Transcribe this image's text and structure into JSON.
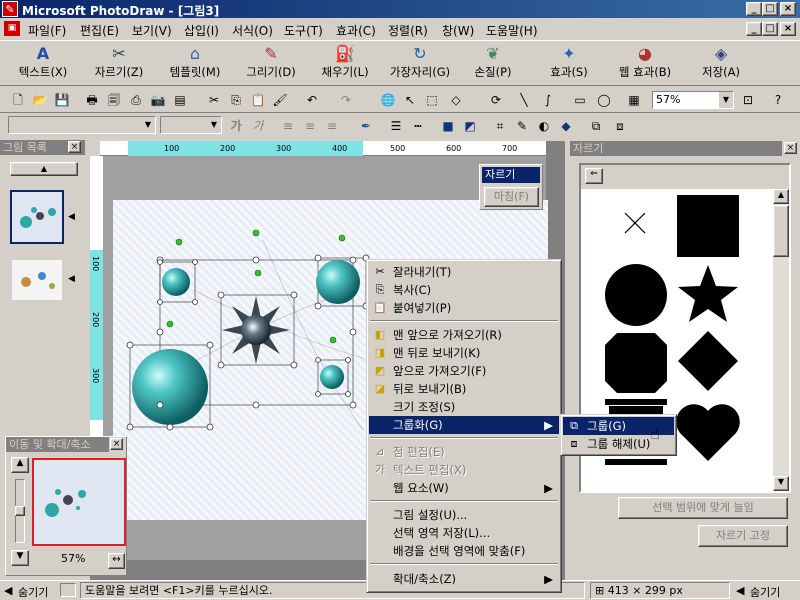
{
  "window": {
    "title": "Microsoft PhotoDraw - [그림3]"
  },
  "menu": [
    "파일(F)",
    "편집(E)",
    "보기(V)",
    "삽입(I)",
    "서식(O)",
    "도구(T)",
    "효과(C)",
    "정렬(R)",
    "창(W)",
    "도움말(H)"
  ],
  "bigtoolbar": [
    {
      "label": "텍스트(X)",
      "icon": "text-icon"
    },
    {
      "label": "자르기(Z)",
      "icon": "scissors-icon"
    },
    {
      "label": "템플릿(M)",
      "icon": "template-icon"
    },
    {
      "label": "그리기(D)",
      "icon": "pencil-icon"
    },
    {
      "label": "채우기(L)",
      "icon": "fill-bucket-icon"
    },
    {
      "label": "가장자리(G)",
      "icon": "edge-icon"
    },
    {
      "label": "손질(P)",
      "icon": "touchup-icon"
    },
    {
      "label": "효과(S)",
      "icon": "effects-icon"
    },
    {
      "label": "웹 효과(B)",
      "icon": "web-effects-icon"
    },
    {
      "label": "저장(A)",
      "icon": "save-icon"
    }
  ],
  "zoom": "57%",
  "left_panel": {
    "title": "그림 목록"
  },
  "navigator": {
    "title": "이동 및 확대/축소",
    "zoom": "57%"
  },
  "ruler": {
    "ticks": [
      "100",
      "200",
      "300",
      "400",
      "500",
      "600",
      "700"
    ]
  },
  "vruler": {
    "ticks": [
      "100",
      "200",
      "300"
    ]
  },
  "crop_popup": {
    "item1": "자르기",
    "item2": "마침(F)"
  },
  "right_panel": {
    "title": "자르기",
    "fit_button": "선택 범위에 맞게 늘임",
    "fix_button": "자르기 고정"
  },
  "context_menu": {
    "items": [
      {
        "label": "잘라내기(T)",
        "icon": "cut-icon",
        "state": "normal"
      },
      {
        "label": "복사(C)",
        "icon": "copy-icon",
        "state": "normal"
      },
      {
        "label": "붙여넣기(P)",
        "icon": "paste-icon",
        "state": "normal"
      },
      {
        "label": "맨 앞으로 가져오기(R)",
        "icon": "bring-front-icon",
        "state": "normal"
      },
      {
        "label": "맨 뒤로 보내기(K)",
        "icon": "send-back-icon",
        "state": "normal"
      },
      {
        "label": "앞으로 가져오기(F)",
        "icon": "bring-forward-icon",
        "state": "normal"
      },
      {
        "label": "뒤로 보내기(B)",
        "icon": "send-backward-icon",
        "state": "normal"
      },
      {
        "label": "크기 조정(S)",
        "icon": "",
        "state": "normal"
      },
      {
        "label": "그룹화(G)",
        "icon": "",
        "state": "selected"
      },
      {
        "label": "점 편집(E)",
        "icon": "point-edit-icon",
        "state": "disabled"
      },
      {
        "label": "텍스트 편집(X)",
        "icon": "text-edit-icon",
        "state": "disabled"
      },
      {
        "label": "웹 요소(W)",
        "icon": "",
        "state": "normal"
      },
      {
        "label": "그림 설정(U)...",
        "icon": "",
        "state": "normal"
      },
      {
        "label": "선택 영역 저장(L)...",
        "icon": "",
        "state": "normal"
      },
      {
        "label": "배경을 선택 영역에 맞춤(F)",
        "icon": "",
        "state": "normal"
      },
      {
        "label": "확대/축소(Z)",
        "icon": "",
        "state": "normal"
      }
    ]
  },
  "submenu": {
    "group": "그룹(G)",
    "ungroup": "그룹 해제(U)"
  },
  "status": {
    "hide_left": "숨기기",
    "help": "도움말을 보려면 <F1>키를 누르십시오.",
    "size": "413 × 299",
    "unit": "px",
    "hide_right": "숨기기"
  }
}
